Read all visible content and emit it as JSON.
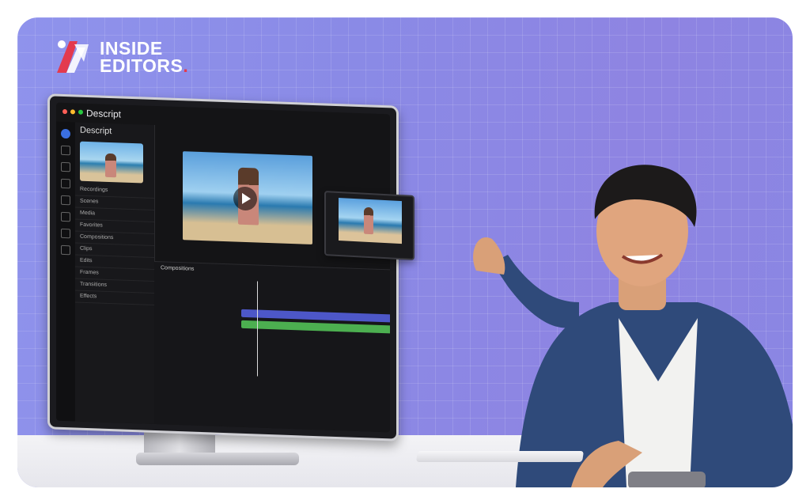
{
  "brand": {
    "name_line1": "INSIDE",
    "name_line2": "EDITORS",
    "dot": ".",
    "accent": "#e33a4e"
  },
  "app": {
    "title": "Descript",
    "project": "Descript",
    "sidebar_items": [
      "Recordings",
      "Scenes",
      "Media",
      "Favorites",
      "Compositions",
      "Clips",
      "Edits",
      "Frames",
      "Transitions",
      "Effects"
    ],
    "viewer_icon": "play-icon",
    "timeline_title": "Compositions"
  },
  "colors": {
    "background": "#8a8ae6",
    "track_blue": "#4d57c8",
    "track_green": "#4caf50"
  }
}
